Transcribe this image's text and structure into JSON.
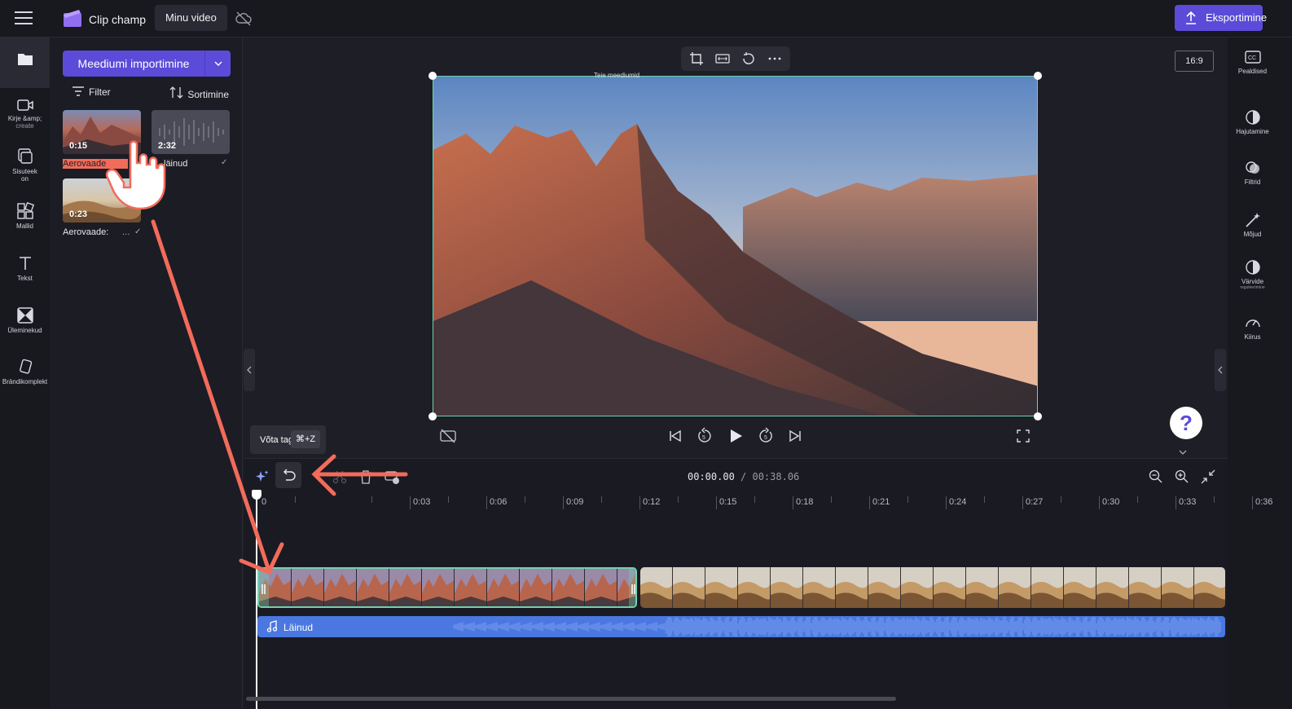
{
  "topbar": {
    "app_name": "Clip champ",
    "project_title": "Minu video",
    "export_label": "Eksportimine"
  },
  "left_nav": {
    "items": [
      {
        "label": "",
        "icon": "folder-icon"
      },
      {
        "label": "Kirje &amp;",
        "sublabel": "create",
        "icon": "camera-icon"
      },
      {
        "label": "Sisuteek",
        "sublabel": "on",
        "icon": "content-library-icon"
      },
      {
        "label": "Mallid",
        "icon": "templates-icon"
      },
      {
        "label": "Tekst",
        "icon": "text-icon"
      },
      {
        "label": "Üleminekud",
        "icon": "transitions-icon"
      },
      {
        "label": "Brändikomplekt",
        "icon": "brand-kit-icon"
      }
    ]
  },
  "media": {
    "import_label": "Meediumi importimine",
    "filter_label": "Filter",
    "sort_label": "Sortimine",
    "items": [
      {
        "duration": "0:15",
        "name": "Aerovaade"
      },
      {
        "duration": "2:32",
        "name": "läinud"
      },
      {
        "duration": "0:23",
        "name": "Aerovaade:",
        "more": "..."
      }
    ]
  },
  "preview": {
    "aspect_ratio": "16:9",
    "frame_label": "Teie meediumid"
  },
  "right_nav": {
    "items": [
      {
        "label": "Pealdised",
        "icon": "captions-icon"
      },
      {
        "label": "Hajutamine",
        "icon": "fade-icon"
      },
      {
        "label": "Filtrid",
        "icon": "filters-icon"
      },
      {
        "label": "Mõjud",
        "icon": "effects-icon"
      },
      {
        "label": "Värvide",
        "sublabel": "reguleerimine",
        "icon": "color-adjust-icon"
      },
      {
        "label": "Kiirus",
        "icon": "speed-icon"
      }
    ]
  },
  "tooltip": {
    "label": "Võta tagasi",
    "shortcut": "⌘+Z"
  },
  "timeline": {
    "current_time": "00:00.00",
    "total_time": "/ 00:38.06",
    "ticks": [
      "0",
      "0:03",
      "0:06",
      "0:09",
      "0:12",
      "0:15",
      "0:18",
      "0:21",
      "0:24",
      "0:27",
      "0:30",
      "0:33",
      "0:36"
    ],
    "audio_label": "Läinud"
  },
  "help_label": "?",
  "colors": {
    "accent": "#5b4bd8",
    "selection": "#6fd1b0",
    "audio": "#4a78e0",
    "annotation": "#f26b5b"
  }
}
